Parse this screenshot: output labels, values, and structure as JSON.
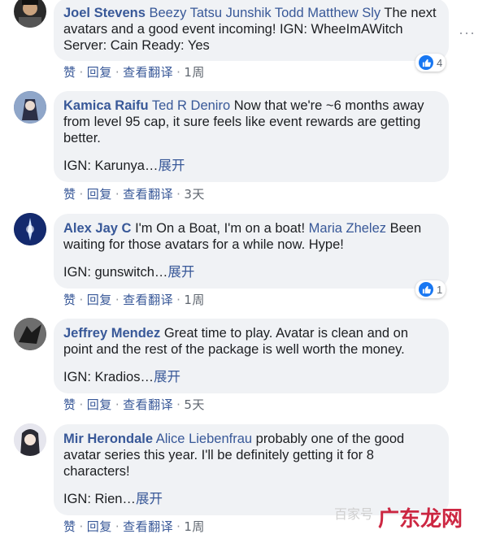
{
  "comments": [
    {
      "author": "Joel Stevens",
      "tags": "Beezy Tatsu Junshik Todd Matthew Sly",
      "text": "The next avatars and a good event incoming! IGN: WheeImAWitch Server: Cain Ready: Yes",
      "ign": "",
      "more": "",
      "time": "1周",
      "likes": "4"
    },
    {
      "author": "Kamica Raifu",
      "tags": "Ted R Deniro",
      "text": "Now that we're ~6 months away from level 95 cap, it sure feels like event rewards are getting better.",
      "ign": "IGN: Karunya…",
      "more": "展开",
      "time": "3天",
      "likes": ""
    },
    {
      "author": "Alex Jay C",
      "tags": "",
      "text": "I'm On a Boat, I'm on a boat!",
      "tags2": "Maria Zhelez",
      "text2": "Been waiting for those avatars for a while now. Hype!",
      "ign": "IGN: gunswitch…",
      "more": "展开",
      "time": "1周",
      "likes": "1"
    },
    {
      "author": "Jeffrey Mendez",
      "tags": "",
      "text": "Great time to play. Avatar is clean and on point and the rest of the package is well worth the money.",
      "ign": "IGN: Kradios…",
      "more": "展开",
      "time": "5天",
      "likes": ""
    },
    {
      "author": "Mir Herondale",
      "tags": "Alice Liebenfrau",
      "text": "probably one of the good avatar series this year. I'll be definitely getting it for 8 characters!",
      "ign": "IGN: Rien…",
      "more": "展开",
      "time": "1周",
      "likes": ""
    }
  ],
  "actions": {
    "like": "赞",
    "reply": "回复",
    "translate": "查看翻译",
    "separator": "·"
  },
  "watermark": "广东龙网",
  "watermark_faint": "百家号",
  "colors": {
    "link": "#385898",
    "bubble": "#f0f2f5",
    "like_badge": "#1877f2",
    "watermark": "#c8102e"
  }
}
